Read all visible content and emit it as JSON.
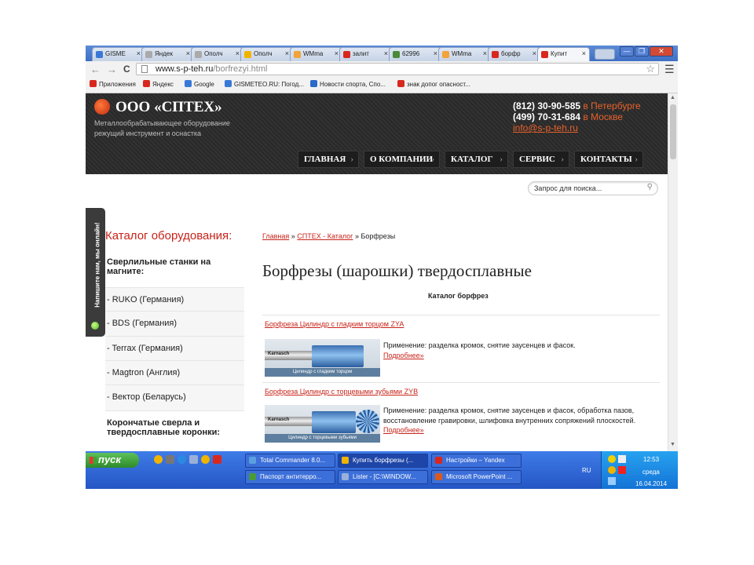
{
  "browser": {
    "tabs": [
      {
        "label": "GISME",
        "color": "#3a78d8"
      },
      {
        "label": "Яндек",
        "color": "#aaaaaa"
      },
      {
        "label": "Ополч",
        "color": "#aaaaaa"
      },
      {
        "label": "Ополч",
        "color": "#f0b400"
      },
      {
        "label": "WMma",
        "color": "#f2a33a"
      },
      {
        "label": "залит",
        "color": "#d8281e"
      },
      {
        "label": "62996",
        "color": "#4a8a3a"
      },
      {
        "label": "WMma",
        "color": "#f2a33a"
      },
      {
        "label": "борфр",
        "color": "#d8281e"
      },
      {
        "label": "Купит",
        "color": "#d8281e"
      }
    ],
    "tab_close": "×",
    "window_controls": {
      "minimize": "—",
      "maximize": "❐",
      "close": "✕"
    },
    "nav": {
      "back": "←",
      "forward": "→",
      "reload": "C"
    },
    "url_host": "www.s-p-teh.ru",
    "url_path": "/borfrezyi.html",
    "bookmarks": [
      {
        "label": "Приложения",
        "color": "#d8281e"
      },
      {
        "label": "Яндекс",
        "color": "#d8281e"
      },
      {
        "label": "Google",
        "color": "#3a78d8"
      },
      {
        "label": "GISMETEO.RU: Погод...",
        "color": "#3a78d8"
      },
      {
        "label": "Новости спорта, Спо...",
        "color": "#2a6ac8"
      },
      {
        "label": "знак допог опасност...",
        "color": "#d8281e"
      }
    ]
  },
  "site": {
    "logo": "ООО «СПТЕХ»",
    "tagline_1": "Металлообрабатывающее оборудование",
    "tagline_2": "режущий инструмент и оснастка",
    "phone_spb": "(812) 30-90-585",
    "city_spb": " в Петербурге",
    "phone_msk": "(499) 70-31-684",
    "city_msk": " в Москве",
    "email": "info@s-p-teh.ru",
    "nav": [
      "ГЛАВНАЯ",
      "О КОМПАНИИ",
      "КАТАЛОГ",
      "СЕРВИС",
      "КОНТАКТЫ"
    ],
    "nav_arrow": "›",
    "search_placeholder": "Запрос для поиска...",
    "chat_label": "Напишите нам, мы онлайн!",
    "catalog_title": "Каталог оборудования:",
    "sidebar": [
      {
        "label": "Сверлильные станки на магните:",
        "group": true
      },
      {
        "label": "- RUKO (Германия)",
        "group": false
      },
      {
        "label": "- BDS (Германия)",
        "group": false
      },
      {
        "label": "- Terrax (Германия)",
        "group": false
      },
      {
        "label": "- Magtron (Англия)",
        "group": false
      },
      {
        "label": "- Вектор (Беларусь)",
        "group": false
      },
      {
        "label": "Корончатые сверла и твердосплавные коронки:",
        "group": true
      }
    ],
    "breadcrumb": {
      "home": "Главная",
      "sep": " » ",
      "catalog": "СПТЕХ - Каталог",
      "current": "Борфрезы"
    },
    "page_title": "Борфрезы (шарошки) твердосплавные",
    "subtitle": "Каталог борфрез",
    "products": [
      {
        "title": "Борфреза Цилиндр с гладким торцом ZYA",
        "image_brand": "Karnasch",
        "image_caption": "Цилиндр с гладким торцом",
        "description": "Применение: разделка кромок, снятие заусенцев и фасок.",
        "more": "Подробнее»"
      },
      {
        "title": "Борфреза Цилиндр с торцевыми зубьями ZYB",
        "image_brand": "Karnasch",
        "image_caption": "Цилиндр с торцевыми зубьями",
        "description": "Применение: разделка кромок, снятие заусенцев и фасок, обработка пазов, восстановление гравировки, шлифовка внутренних сопряжений плоскостей.",
        "more": "Подробнее»"
      }
    ]
  },
  "taskbar": {
    "start": "пуск",
    "tasks": [
      {
        "label": "Total Commander 8.0...",
        "color": "#5aa0e0"
      },
      {
        "label": "Купить борфрезы (...",
        "color": "#f0b400"
      },
      {
        "label": "Настройки – Yandex",
        "color": "#d8281e"
      },
      {
        "label": "Паспорт антитерро...",
        "color": "#4a9a3a"
      },
      {
        "label": "Lister - [C:\\WINDOW...",
        "color": "#9ab0d8"
      },
      {
        "label": "Microsoft PowerPoint ...",
        "color": "#d85a1e"
      }
    ],
    "language": "RU",
    "time": "12:53",
    "day": "среда",
    "date": "16.04.2014"
  }
}
